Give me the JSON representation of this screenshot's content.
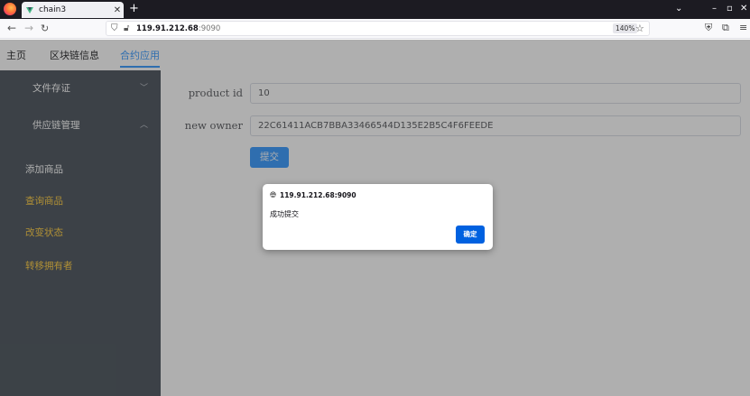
{
  "browser": {
    "tab_title": "chain3",
    "url_host": "119.91.212.68",
    "url_port": ":9090",
    "zoom": "140%"
  },
  "topnav": {
    "items": [
      "主页",
      "区块链信息",
      "合约应用"
    ],
    "active_index": 2
  },
  "sidebar": {
    "submenus": [
      {
        "label": "文件存证",
        "expanded": false
      },
      {
        "label": "供应链管理",
        "expanded": true
      }
    ],
    "items": [
      {
        "label": "添加商品",
        "color": "#ffffff"
      },
      {
        "label": "查询商品",
        "color": "#ffd04b"
      },
      {
        "label": "改变状态",
        "color": "#ffd04b"
      },
      {
        "label": "转移拥有者",
        "color": "#ffd04b"
      }
    ]
  },
  "form": {
    "product_id_label": "product id",
    "product_id_value": "10",
    "new_owner_label": "new owner",
    "new_owner_value": "22C61411ACB7BBA33466544D135E2B5C4F6FEEDE",
    "submit_label": "提交"
  },
  "dialog": {
    "origin": "119.91.212.68:9090",
    "message": "成功提交",
    "ok_label": "确定"
  },
  "colors": {
    "accent": "#409eff",
    "sidebar_bg": "#545c64",
    "active_menu_text": "#ffd04b",
    "dialog_button": "#0061e0"
  }
}
